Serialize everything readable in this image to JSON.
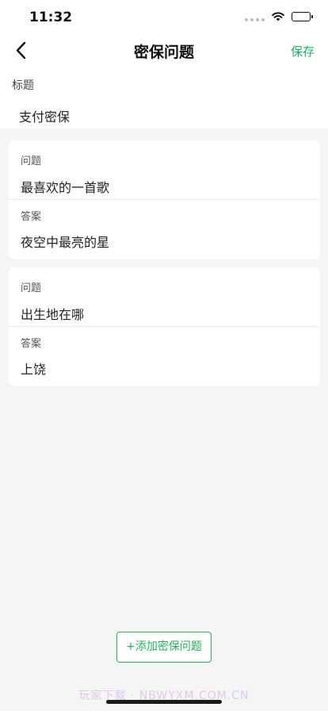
{
  "status_bar": {
    "time": "11:32",
    "icons": [
      "signal-dots-icon",
      "wifi-icon",
      "battery-icon"
    ]
  },
  "nav": {
    "back_icon": "chevron-left-icon",
    "title": "密保问题",
    "save_label": "保存"
  },
  "title_section": {
    "label": "标题",
    "value": "支付密保"
  },
  "questions": [
    {
      "question_label": "问题",
      "question": "最喜欢的一首歌",
      "answer_label": "答案",
      "answer": "夜空中最亮的星"
    },
    {
      "question_label": "问题",
      "question": "出生地在哪",
      "answer_label": "答案",
      "answer": "上饶"
    }
  ],
  "add_button_label": "+添加密保问题",
  "watermark": "玩家下载 · NBWYXM.COM.CN",
  "colors": {
    "accent": "#1fb35c",
    "background": "#f5f5f5"
  }
}
